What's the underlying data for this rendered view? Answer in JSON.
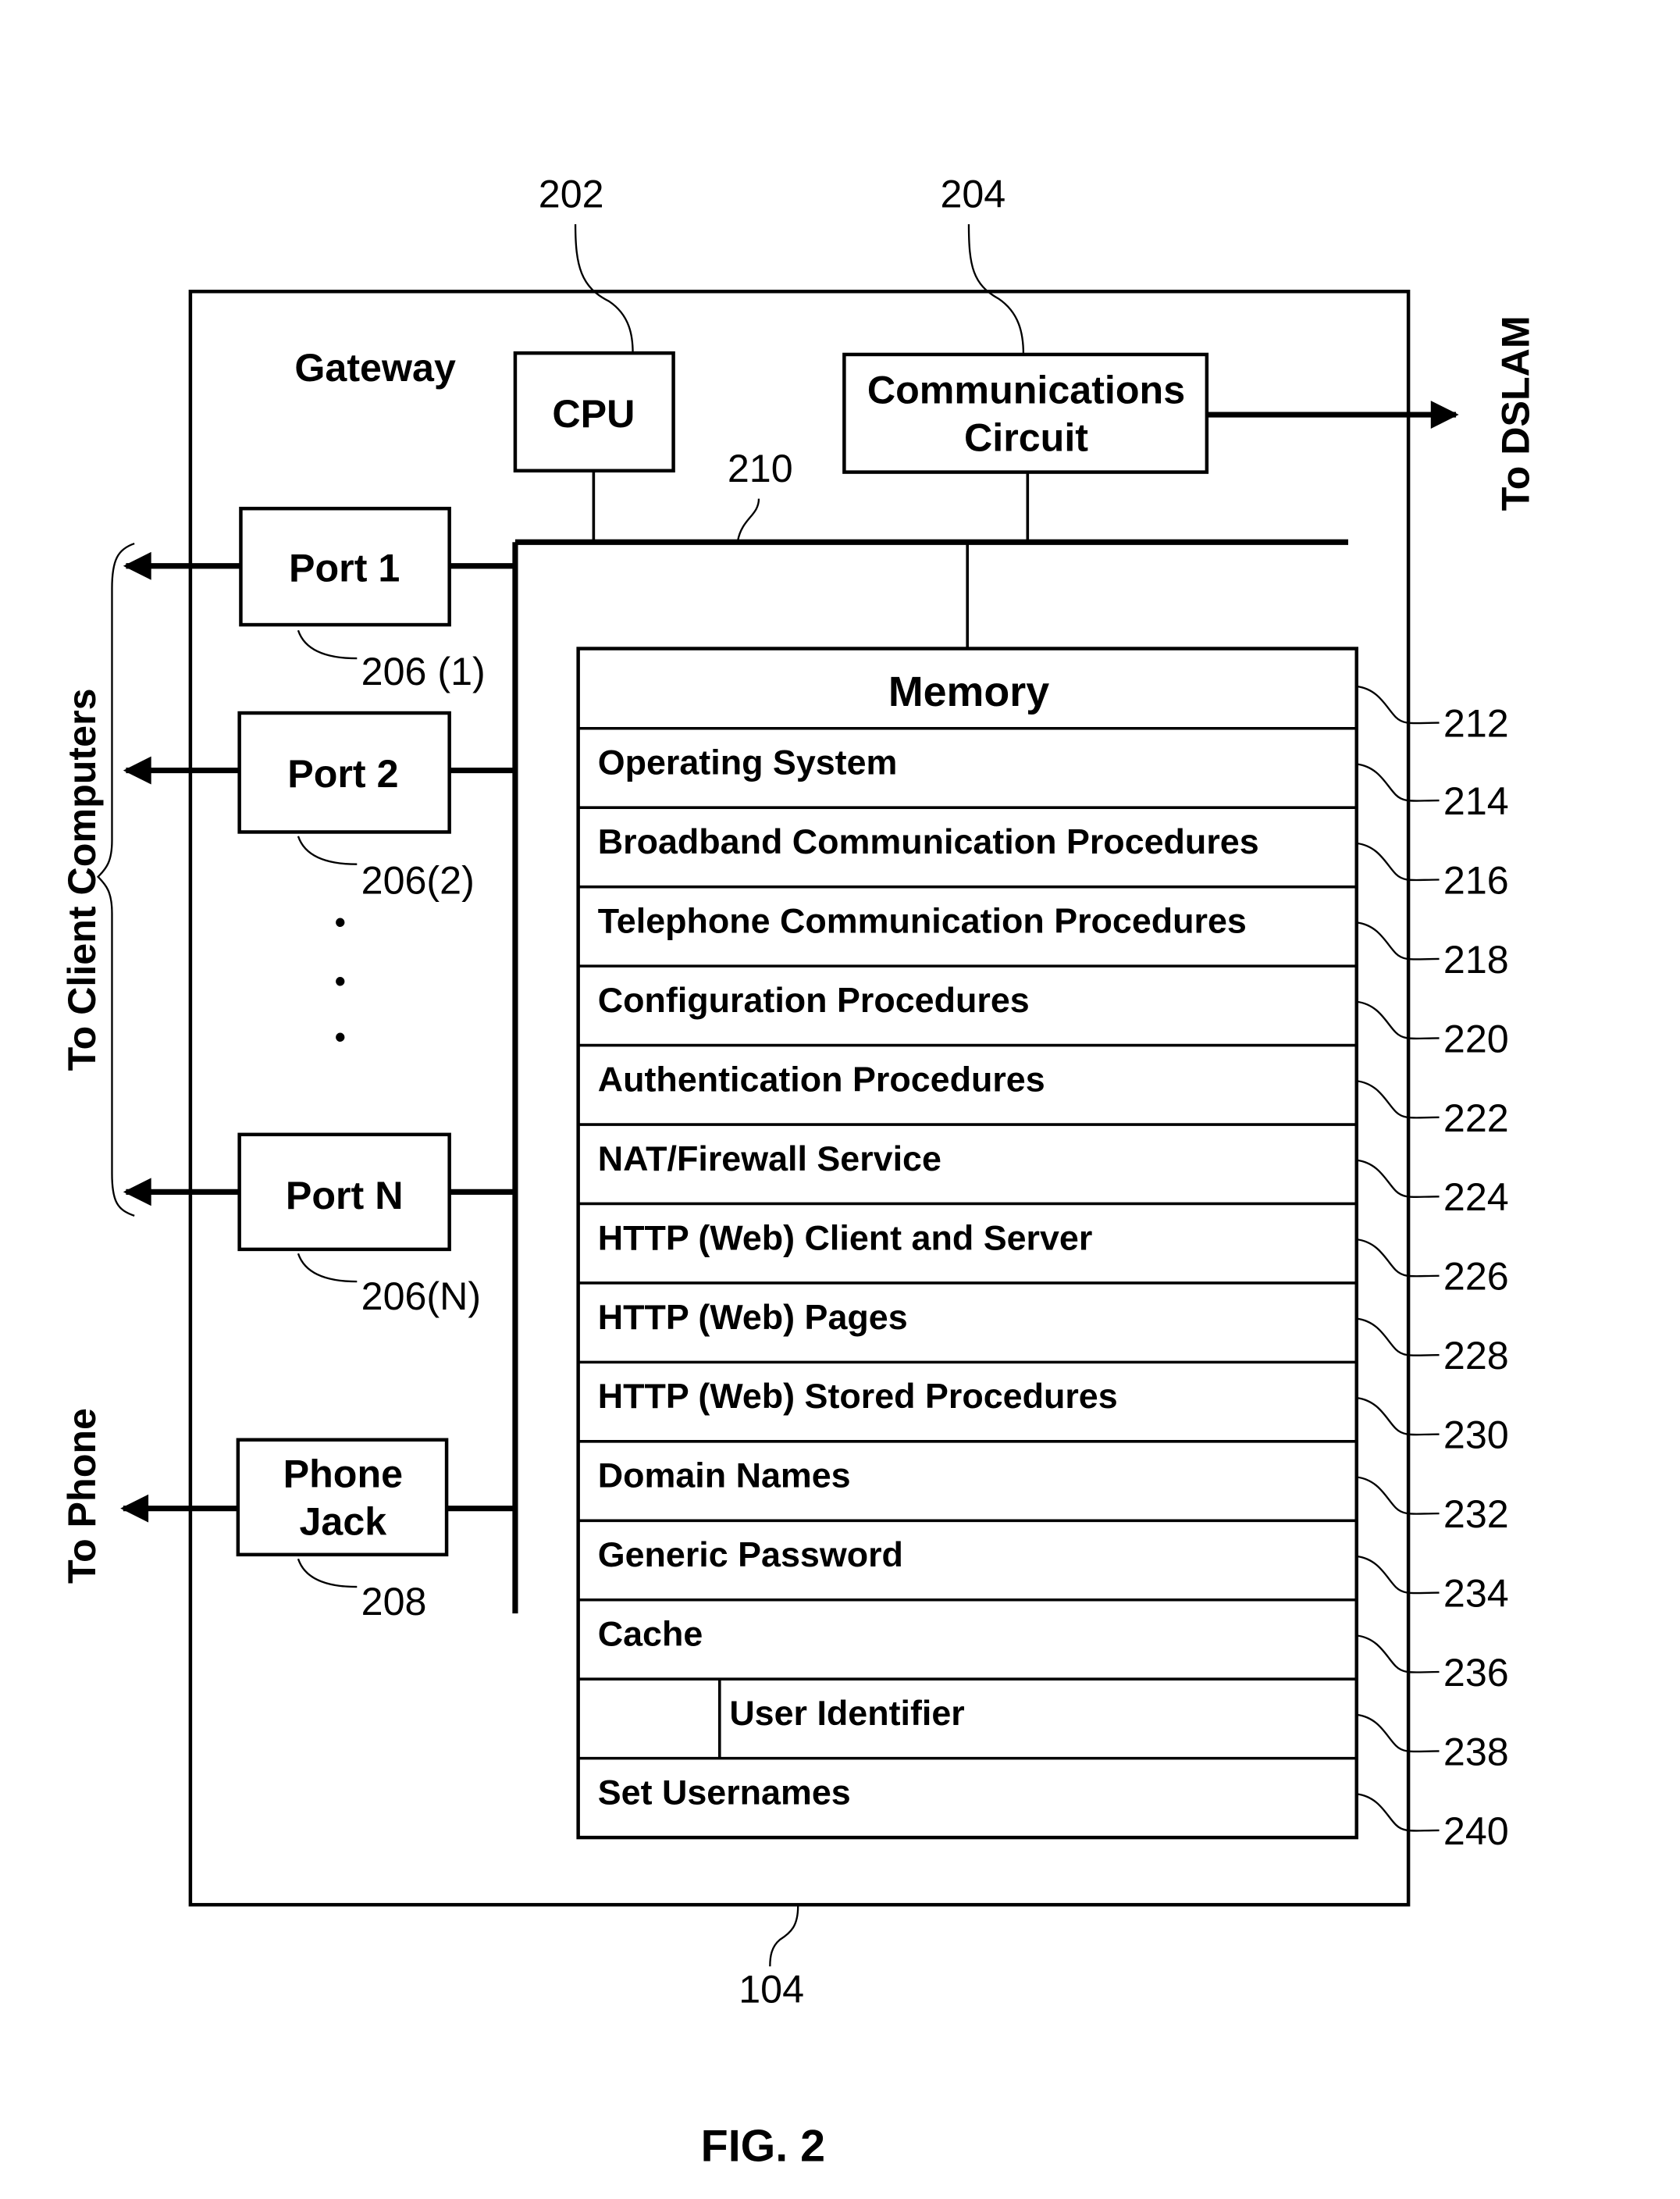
{
  "figure": {
    "caption": "FIG. 2",
    "gateway_label": "Gateway",
    "gateway_ref": "104",
    "bus_ref": "210"
  },
  "cpu": {
    "label": "CPU",
    "ref": "202"
  },
  "communications_circuit": {
    "line1": "Communications",
    "line2": "Circuit",
    "ref": "204"
  },
  "external_labels": {
    "to_dslam": "To DSLAM",
    "to_client_computers": "To Client Computers",
    "to_phone": "To Phone"
  },
  "ports": [
    {
      "label": "Port 1",
      "ref": "206 (1)"
    },
    {
      "label": "Port 2",
      "ref": "206(2)"
    },
    {
      "label": "Port N",
      "ref": "206(N)"
    }
  ],
  "ellipsis": "•",
  "phone_jack": {
    "line1": "Phone",
    "line2": "Jack",
    "ref": "208"
  },
  "memory": {
    "title": "Memory",
    "title_ref": "212",
    "rows": [
      {
        "label": "Operating System",
        "ref": "214"
      },
      {
        "label": "Broadband Communication Procedures",
        "ref": "216"
      },
      {
        "label": "Telephone Communication Procedures",
        "ref": "218"
      },
      {
        "label": "Configuration Procedures",
        "ref": "220"
      },
      {
        "label": "Authentication Procedures",
        "ref": "222"
      },
      {
        "label": "NAT/Firewall Service",
        "ref": "224"
      },
      {
        "label": "HTTP (Web) Client and Server",
        "ref": "226"
      },
      {
        "label": "HTTP (Web) Pages",
        "ref": "228"
      },
      {
        "label": "HTTP (Web) Stored Procedures",
        "ref": "230"
      },
      {
        "label": "Domain Names",
        "ref": "232"
      },
      {
        "label": "Generic Password",
        "ref": "234"
      },
      {
        "label": "Cache",
        "ref": "236"
      },
      {
        "label": "User Identifier",
        "ref": "238"
      },
      {
        "label": "Set Usernames",
        "ref": "240"
      }
    ]
  }
}
